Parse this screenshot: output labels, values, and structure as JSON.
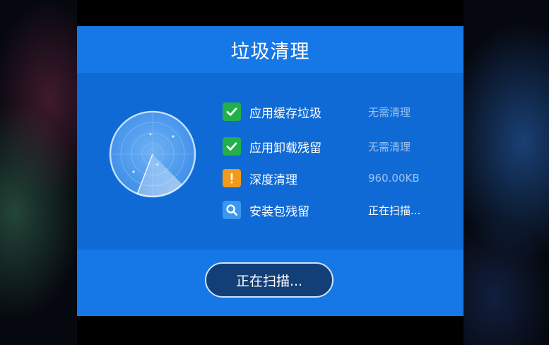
{
  "dialog": {
    "title": "垃圾清理",
    "items": [
      {
        "icon": "checkmark-icon",
        "label": "应用缓存垃圾",
        "status": "无需清理"
      },
      {
        "icon": "checkmark-icon",
        "label": "应用卸载残留",
        "status": "无需清理"
      },
      {
        "icon": "exclamation-icon",
        "label": "深度清理",
        "status": "960.00KB"
      },
      {
        "icon": "magnifier-icon",
        "label": "安装包残留",
        "status": "正在扫描..."
      }
    ],
    "button_label": "正在扫描..."
  },
  "colors": {
    "dialog_blue": "#1675e4",
    "content_blue": "#106ad6",
    "success_green": "#22b04a",
    "warning_orange": "#f29a1a",
    "scan_blue": "#3b97f0",
    "button_navy": "#123f78"
  }
}
